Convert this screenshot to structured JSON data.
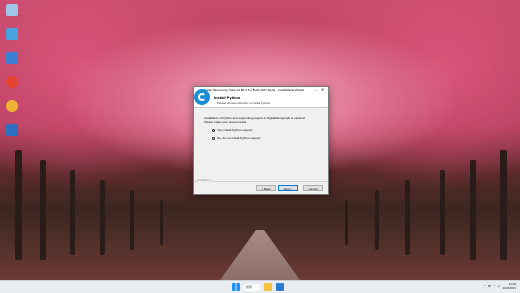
{
  "desktop": {
    "icons": [
      {
        "label": "",
        "icon": "recycle-bin-icon",
        "color": "#9fc6e8"
      },
      {
        "label": "",
        "icon": "computer-icon",
        "color": "#4aa3df"
      },
      {
        "label": "",
        "icon": "folder-icon",
        "color": "#3b7fd1"
      },
      {
        "label": "",
        "icon": "chrome-icon",
        "color": "#e4432d"
      },
      {
        "label": "",
        "icon": "app-icon",
        "color": "#f2b233"
      },
      {
        "label": "",
        "icon": "network-icon",
        "color": "#2c6fbe"
      }
    ]
  },
  "dialog": {
    "title": "Gatan Microscopy Suite 64 Bit 3.5.2 Build 4037 Alpha - InstallShield Wizard",
    "header_title": "Install Python",
    "header_subtitle": "Please choose whether to install Python.",
    "description": "Installation of Python and supporting plugins in DigitalMicrograph is optional. Please make your choice below.",
    "options": [
      {
        "label": "Yes, install Python support",
        "selected": true
      },
      {
        "label": "No, do not install Python support",
        "selected": false
      }
    ],
    "brand": "InstallShield",
    "buttons": {
      "back": "< Back",
      "next": "Next >",
      "cancel": "Cancel"
    }
  },
  "taskbar": {
    "search": "搜索",
    "language": "中",
    "time": "13:09",
    "date": "2024/8/19"
  }
}
